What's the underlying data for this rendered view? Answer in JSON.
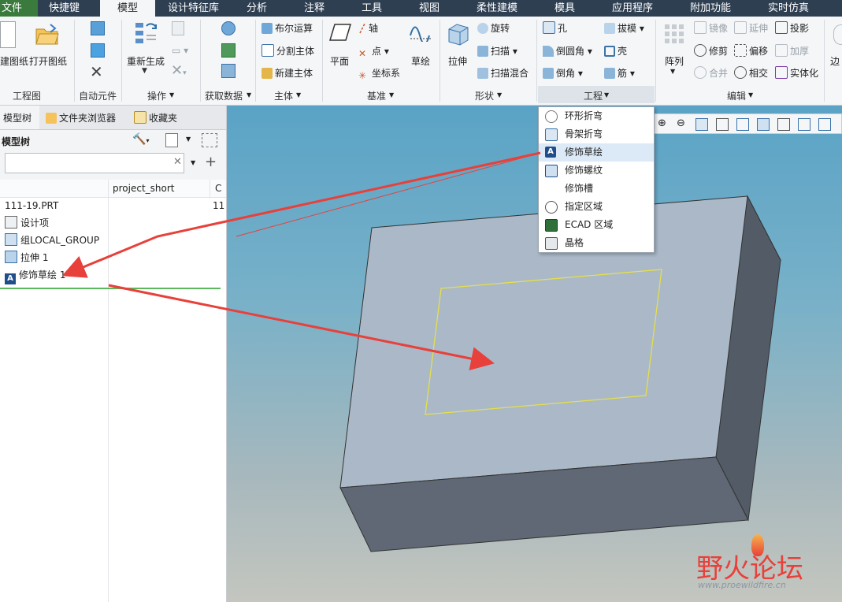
{
  "menubar": {
    "items": [
      "文件",
      "快捷键",
      "模型",
      "设计特征库",
      "分析",
      "注释",
      "工具",
      "视图",
      "柔性建模",
      "模具",
      "应用程序",
      "附加功能",
      "实时仿真"
    ],
    "active_index": 2
  },
  "ribbon": {
    "groups": {
      "drawing": {
        "label": "工程图",
        "cmd1": "建图纸",
        "cmd2": "打开图纸"
      },
      "auto_component": {
        "label": "自动元件"
      },
      "operations": {
        "label": "操作",
        "regen": "重新生成"
      },
      "get_data": {
        "label": "获取数据"
      },
      "body": {
        "label": "主体",
        "boolean": "布尔运算",
        "split": "分割主体",
        "new": "新建主体"
      },
      "datum": {
        "label": "基准",
        "plane": "平面",
        "axis": "轴",
        "point": "点",
        "csys": "坐标系",
        "sketch": "草绘"
      },
      "shapes": {
        "label": "形状",
        "extrude": "拉伸",
        "revolve": "旋转",
        "sweep": "扫描",
        "swept_blend": "扫描混合"
      },
      "engineering": {
        "label": "工程",
        "hole": "孔",
        "round": "倒圆角",
        "chamfer": "倒角",
        "draft": "拔模",
        "shell": "壳",
        "rib": "筋"
      },
      "editing": {
        "label": "编辑",
        "pattern": "阵列",
        "mirror": "镜像",
        "extend": "延伸",
        "project": "投影",
        "trim": "修剪",
        "offset": "偏移",
        "thicken": "加厚",
        "merge": "合并",
        "intersect": "相交",
        "solidify": "实体化"
      },
      "surfaces": {
        "label": "边"
      }
    }
  },
  "left_panel": {
    "tabs": [
      "模型树",
      "文件夹浏览器",
      "收藏夹"
    ],
    "tree_title": "模型树",
    "search_placeholder": "",
    "columns": [
      "project_short",
      "C"
    ],
    "rows": [
      {
        "label": "111-19.PRT",
        "col2": "11"
      },
      {
        "label": "设计项",
        "col2": ""
      },
      {
        "label": "组LOCAL_GROUP",
        "col2": ""
      },
      {
        "label": "拉伸 1",
        "col2": ""
      },
      {
        "label": "修饰草绘 1",
        "col2": ""
      }
    ]
  },
  "dropdown": {
    "items": [
      "环形折弯",
      "骨架折弯",
      "修饰草绘",
      "修饰螺纹",
      "修饰槽",
      "指定区域",
      "ECAD 区域",
      "晶格"
    ],
    "highlighted_index": 2
  },
  "watermark": {
    "title": "野火论坛",
    "url": "www.proewildfire.cn"
  },
  "colors": {
    "menubar": "#2e3f52",
    "file_tab": "#3a7a3c",
    "arrow": "#e8403a",
    "sketch_outline": "#e5e04a",
    "box_top": "#aab8c8",
    "box_front": "#5f6874",
    "box_side": "#525b66"
  }
}
